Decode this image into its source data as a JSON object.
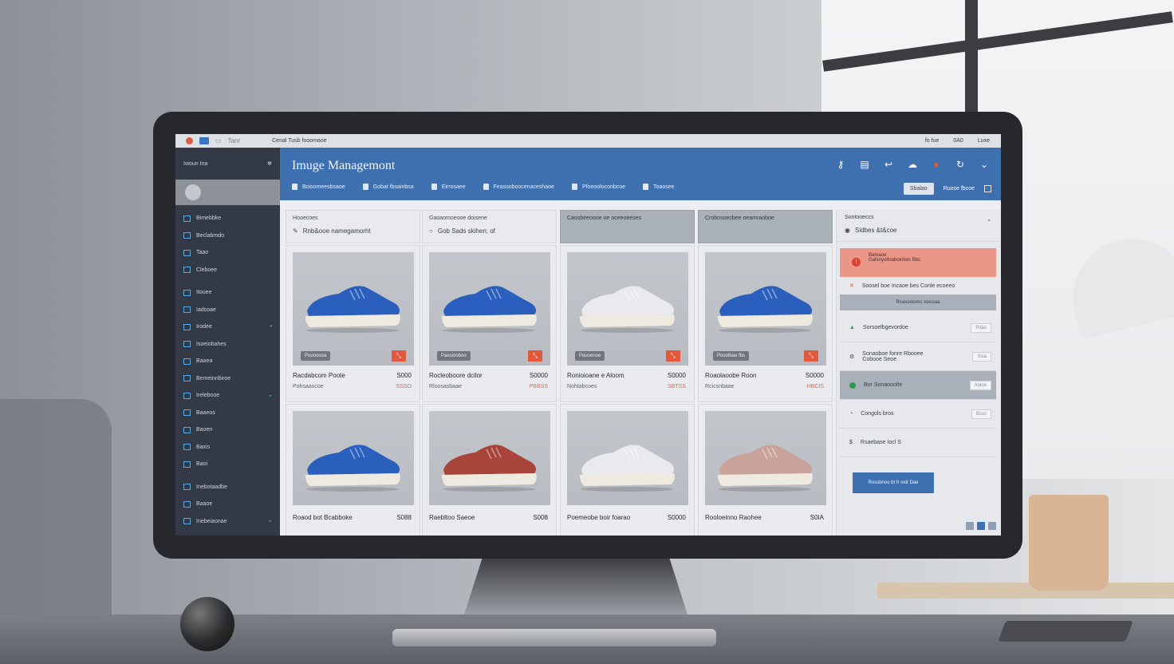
{
  "titlebar": {
    "title": "Cenal Tusb fooomaoe",
    "left_label": "Tanr",
    "right_items": [
      "fo fue",
      "0A0",
      "Luxe"
    ]
  },
  "sidebar": {
    "header": "Iwoun Ina",
    "items": [
      {
        "label": "Bimebbke",
        "badge": ""
      },
      {
        "label": "Beclabmdo",
        "badge": ""
      },
      {
        "label": "Taao",
        "badge": ""
      },
      {
        "label": "Cleboee",
        "badge": ""
      },
      {
        "label": "Itouee",
        "badge": ""
      },
      {
        "label": "Iadsoae",
        "badge": ""
      },
      {
        "label": "Irodee",
        "badge": "•"
      },
      {
        "label": "Isoeiobahes",
        "badge": ""
      },
      {
        "label": "Baaea",
        "badge": ""
      },
      {
        "label": "Bemeinnbiroe",
        "badge": ""
      },
      {
        "label": "Irelebooe",
        "badge": "⌁"
      },
      {
        "label": "Baaeos",
        "badge": ""
      },
      {
        "label": "Baoen",
        "badge": ""
      },
      {
        "label": "Baxis",
        "badge": ""
      },
      {
        "label": "Baoi",
        "badge": ""
      },
      {
        "label": "Inebotaadbe",
        "badge": ""
      },
      {
        "label": "Baaoe",
        "badge": ""
      },
      {
        "label": "Inebeiaonae",
        "badge": "⌁"
      }
    ]
  },
  "header": {
    "title": "Imuge Managemont",
    "tabs": [
      "Boisomeesbsaoe",
      "Gobat fbsainbsa",
      "Eirrosaee",
      "Feassoboocenaceshaoe",
      "Pfoeooloconbcoe",
      "Toaosee"
    ],
    "action_button": "Sbalao",
    "action_label": "Ruose fbcoe"
  },
  "columns": [
    {
      "title": "Hooecoes",
      "subtitle": "Rnb&ooe namegamorht"
    },
    {
      "title": "Gaoaomoeooe doisene",
      "subtitle": "Gob Sads skihen; of"
    },
    {
      "title": "Caosbeeoooe oe oceeoeeses",
      "subtitle": ""
    },
    {
      "title": "Crobosoecbee oeamraoboe",
      "subtitle": ""
    }
  ],
  "cards": [
    {
      "name": "Racdabcom Poote",
      "price": "S000",
      "meta": "Pohsaascoe",
      "stock": "SSSO",
      "tag": "Pooooooa",
      "color": "#2b5fbd"
    },
    {
      "name": "Rocleoboore dcilor",
      "price": "S0000",
      "meta": "Rloosasbaae",
      "stock": "PBBSS",
      "tag": "Paesiooboo",
      "color": "#2b5fbd"
    },
    {
      "name": "Ronioioane e Aloom",
      "price": "S0000",
      "meta": "Nohtabcoes",
      "stock": "SBTSS",
      "tag": "Pauoenoe",
      "color": "#e8eaee"
    },
    {
      "name": "Roaolaoobe Roon",
      "price": "S0000",
      "meta": "Rcicsnbaae",
      "stock": "HBCIS",
      "tag": "Pooolbae fbs",
      "color": "#2b5fbd"
    },
    {
      "name": "Roaod bot Bcabboke",
      "price": "S088",
      "meta": "",
      "stock": "",
      "tag": "",
      "color": "#2b5fbd"
    },
    {
      "name": "Raebltoo Saeoe",
      "price": "S008",
      "meta": "",
      "stock": "",
      "tag": "",
      "color": "#a8443a"
    },
    {
      "name": "Poemeobe boir foarao",
      "price": "S0000",
      "meta": "",
      "stock": "",
      "tag": "",
      "color": "#e8eaee"
    },
    {
      "name": "Rooloeinno Raohee",
      "price": "S0IA",
      "meta": "",
      "stock": "",
      "tag": "",
      "color": "#c9a39a"
    }
  ],
  "rpanel": {
    "title": "Sontooeccs",
    "selected": "Sidbes &t&coe",
    "alert_line1": "Bamaoe",
    "alert_line2": "Gafsnyoifoaboinbes Bbs",
    "row_label": "Soosel boe Incaoe bes Conle ecoeeo",
    "section": "Rcasoioomc soicsaa",
    "options": [
      {
        "label": "Sorsoelbgevordoe",
        "pill": "Pdas"
      },
      {
        "label": "Sonaoboe fonre Rbooee\nCobooe Seoe",
        "pill": "Ssia"
      },
      {
        "label": "Bor Sonaooolte",
        "pill": "Aoioe"
      },
      {
        "label": "Congols bros",
        "pill": "Bsss"
      },
      {
        "label": "Rsaebase Iocl S",
        "pill": ""
      }
    ],
    "button": "Rossbnoo bt fr oeit Dae"
  },
  "colors": {
    "accent": "#3e6fae",
    "sidebar": "#333a46",
    "alert": "#ea9788",
    "danger": "#e3573a"
  }
}
